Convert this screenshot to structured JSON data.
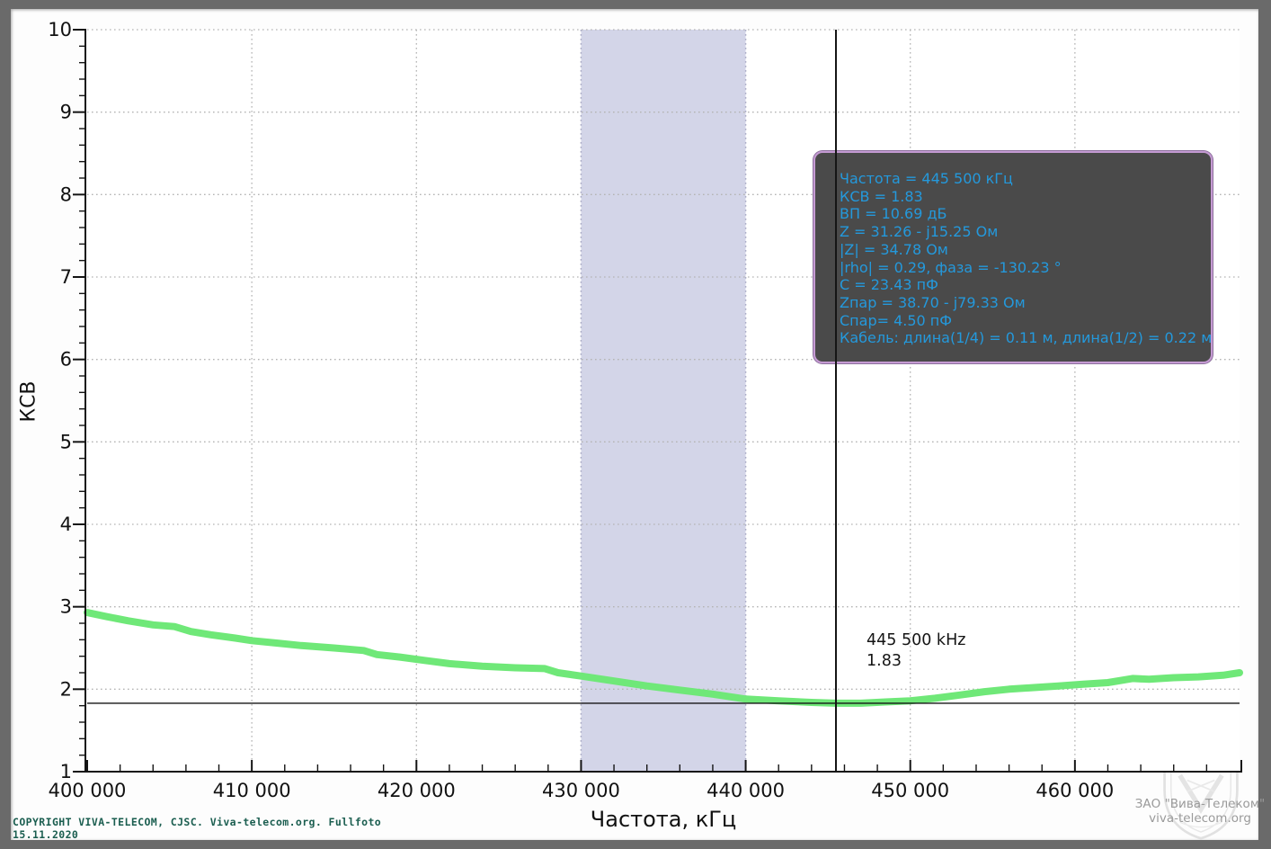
{
  "app": {
    "frame_color": "#6a6a6a",
    "background_color": "#fdfdfd"
  },
  "chart_data": {
    "type": "line",
    "title": "",
    "xlabel": "Частота, кГц",
    "ylabel": "КСВ",
    "xlim": [
      400000,
      470000
    ],
    "ylim": [
      1,
      10
    ],
    "grid": "dotted",
    "legend_position": "none",
    "x_ticks": [
      {
        "value": 400000,
        "label": "400 000"
      },
      {
        "value": 410000,
        "label": "410 000"
      },
      {
        "value": 420000,
        "label": "420 000"
      },
      {
        "value": 430000,
        "label": "430 000"
      },
      {
        "value": 440000,
        "label": "440 000"
      },
      {
        "value": 450000,
        "label": "450 000"
      },
      {
        "value": 460000,
        "label": "460 000"
      }
    ],
    "y_ticks": [
      {
        "value": 1,
        "label": "1"
      },
      {
        "value": 2,
        "label": "2"
      },
      {
        "value": 3,
        "label": "3"
      },
      {
        "value": 4,
        "label": "4"
      },
      {
        "value": 5,
        "label": "5"
      },
      {
        "value": 6,
        "label": "6"
      },
      {
        "value": 7,
        "label": "7"
      },
      {
        "value": 8,
        "label": "8"
      },
      {
        "value": 9,
        "label": "9"
      },
      {
        "value": 10,
        "label": "10"
      }
    ],
    "x_minor_step": 2000,
    "y_minor_step": 0.2,
    "band": {
      "from": 430000,
      "to": 440000,
      "color": "#d3d5e8",
      "edge_color": "#a9abc8"
    },
    "series": [
      {
        "name": "КСВ",
        "color": "#6fe878",
        "points": [
          [
            400000,
            2.93
          ],
          [
            401200,
            2.88
          ],
          [
            402500,
            2.83
          ],
          [
            404000,
            2.78
          ],
          [
            405300,
            2.76
          ],
          [
            406300,
            2.7
          ],
          [
            407500,
            2.66
          ],
          [
            409000,
            2.62
          ],
          [
            410000,
            2.59
          ],
          [
            411500,
            2.56
          ],
          [
            413000,
            2.53
          ],
          [
            415000,
            2.5
          ],
          [
            416800,
            2.47
          ],
          [
            417600,
            2.42
          ],
          [
            419000,
            2.39
          ],
          [
            420500,
            2.35
          ],
          [
            422000,
            2.31
          ],
          [
            424000,
            2.28
          ],
          [
            426000,
            2.26
          ],
          [
            427800,
            2.25
          ],
          [
            428600,
            2.2
          ],
          [
            430000,
            2.16
          ],
          [
            432000,
            2.1
          ],
          [
            434000,
            2.04
          ],
          [
            436000,
            1.99
          ],
          [
            438000,
            1.94
          ],
          [
            440000,
            1.88
          ],
          [
            442000,
            1.86
          ],
          [
            444000,
            1.84
          ],
          [
            445500,
            1.83
          ],
          [
            447000,
            1.83
          ],
          [
            448500,
            1.845
          ],
          [
            450000,
            1.86
          ],
          [
            451500,
            1.89
          ],
          [
            453000,
            1.93
          ],
          [
            454500,
            1.97
          ],
          [
            456000,
            2.0
          ],
          [
            457500,
            2.02
          ],
          [
            459000,
            2.04
          ],
          [
            460500,
            2.06
          ],
          [
            462000,
            2.08
          ],
          [
            463500,
            2.13
          ],
          [
            464500,
            2.12
          ],
          [
            466000,
            2.14
          ],
          [
            467500,
            2.15
          ],
          [
            469000,
            2.17
          ],
          [
            470000,
            2.2
          ]
        ]
      }
    ],
    "cursor": {
      "frequency_khz": 445500,
      "vswr": 1.83,
      "label_freq": "445 500 kHz",
      "label_value": "1.83",
      "color": "#151515"
    },
    "grid_color": "#b4b4b4",
    "axis_color": "#141414"
  },
  "tooltip": {
    "bg": "#4a4a4a",
    "border": "#c59bd3",
    "text_color": "#2499dc",
    "lines": [
      "Частота = 445 500 кГц",
      "КСВ = 1.83",
      "ВП = 10.69 дБ",
      "Z = 31.26 - j15.25 Ом",
      "|Z| = 34.78 Ом",
      "|rho| = 0.29, фаза = -130.23 °",
      "C = 23.43 пФ",
      "Zпар = 38.70 - j79.33 Ом",
      "Спар= 4.50 пФ",
      "Кабель: длина(1/4) = 0.11 м, длина(1/2) = 0.22 м"
    ]
  },
  "footer": {
    "copyright": "COPYRIGHT VIVA-TELECOM, CJSC. Viva-telecom.org. Fullfoto",
    "date": "15.11.2020",
    "text_color": "#1b5e50"
  },
  "watermark": {
    "line1": "ЗАО \"Вива-Телеком\"",
    "line2": "viva-telecom.org",
    "text_color": "#9a9a9a"
  }
}
